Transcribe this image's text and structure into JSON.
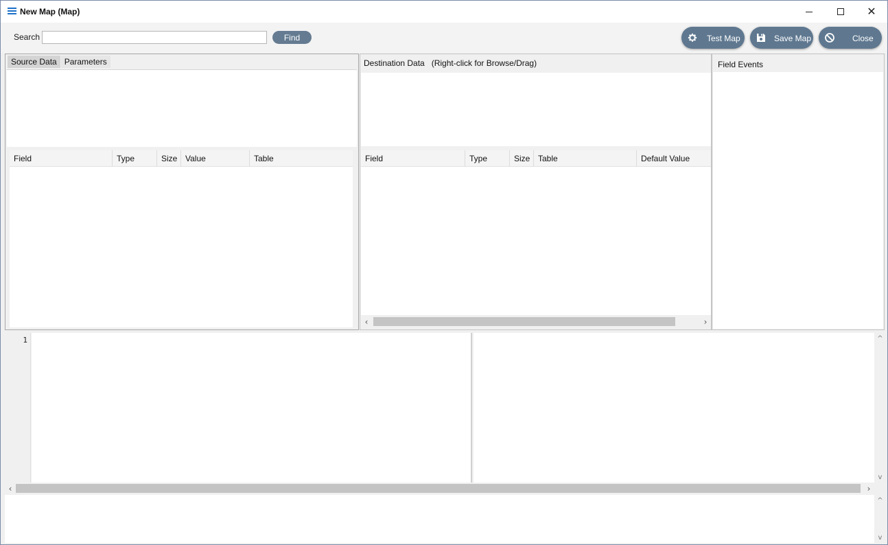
{
  "window": {
    "title": "New Map (Map)",
    "controls": {
      "minimize": "minimize",
      "maximize": "maximize",
      "close": "✕"
    }
  },
  "toolbar": {
    "search_label": "Search",
    "search_value": "",
    "find_label": "Find",
    "test_map_label": "Test Map",
    "save_map_label": "Save Map",
    "close_label": "Close"
  },
  "source_panel": {
    "tabs": [
      {
        "label": "Source Data",
        "active": true
      },
      {
        "label": "Parameters",
        "active": false
      }
    ],
    "columns": [
      "Field",
      "Type",
      "Size",
      "Value",
      "Table"
    ]
  },
  "destination_panel": {
    "title": "Destination Data   (Right-click for Browse/Drag)",
    "columns": [
      "Field",
      "Type",
      "Size",
      "Table",
      "Default Value"
    ],
    "scroll_left": "‹",
    "scroll_right": "›"
  },
  "field_events_panel": {
    "title": "Field Events"
  },
  "editor": {
    "line_numbers": [
      "1"
    ],
    "scroll_left": "‹",
    "scroll_right": "›",
    "scroll_up": "^",
    "scroll_down": "v"
  },
  "output": {
    "scroll_up": "^",
    "scroll_down": "v"
  },
  "colors": {
    "button_bg": "#5f7890",
    "find_bg": "#647b91",
    "app_icon": "#1b6fc8"
  }
}
